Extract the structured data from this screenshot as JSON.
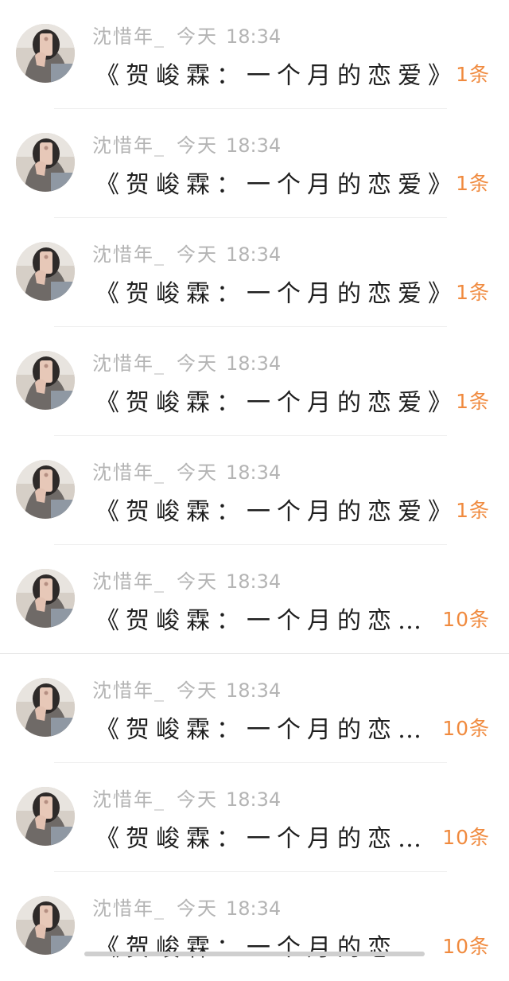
{
  "messages": [
    {
      "author": "沈惜年_",
      "day": "今天",
      "time": "18:34",
      "title": "《贺峻霖：一个月的恋爱》",
      "count": "1条"
    },
    {
      "author": "沈惜年_",
      "day": "今天",
      "time": "18:34",
      "title": "《贺峻霖：一个月的恋爱》",
      "count": "1条"
    },
    {
      "author": "沈惜年_",
      "day": "今天",
      "time": "18:34",
      "title": "《贺峻霖：一个月的恋爱》",
      "count": "1条"
    },
    {
      "author": "沈惜年_",
      "day": "今天",
      "time": "18:34",
      "title": "《贺峻霖：一个月的恋爱》",
      "count": "1条"
    },
    {
      "author": "沈惜年_",
      "day": "今天",
      "time": "18:34",
      "title": "《贺峻霖：一个月的恋爱》",
      "count": "1条"
    },
    {
      "author": "沈惜年_",
      "day": "今天",
      "time": "18:34",
      "title": "《贺峻霖：一个月的恋…",
      "count": "10条"
    },
    {
      "author": "沈惜年_",
      "day": "今天",
      "time": "18:34",
      "title": "《贺峻霖：一个月的恋…",
      "count": "10条"
    },
    {
      "author": "沈惜年_",
      "day": "今天",
      "time": "18:34",
      "title": "《贺峻霖：一个月的恋…",
      "count": "10条"
    },
    {
      "author": "沈惜年_",
      "day": "今天",
      "time": "18:34",
      "title": "《贺峻霖：一个月的恋…",
      "count": "10条"
    }
  ],
  "colors": {
    "meta_text": "#b4b4b4",
    "title_text": "#1f1f1f",
    "count_accent": "#f08a3e"
  },
  "icons": {
    "avatar": "user-photo-avatar"
  }
}
